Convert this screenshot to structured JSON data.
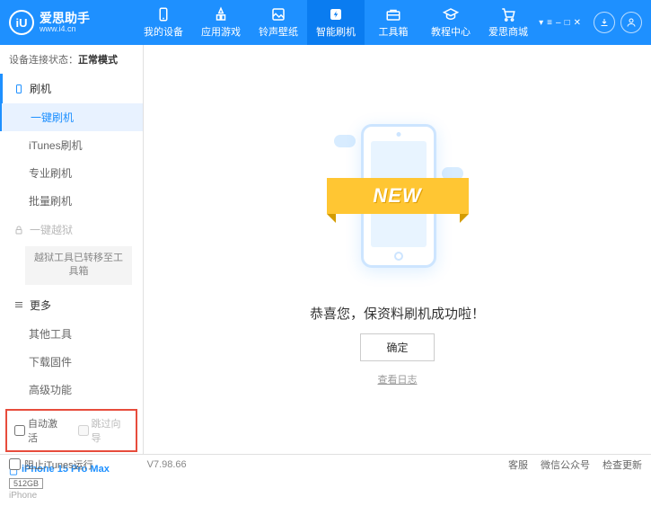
{
  "app": {
    "name": "爱思助手",
    "url": "www.i4.cn",
    "logo": "iU"
  },
  "nav": [
    {
      "label": "我的设备"
    },
    {
      "label": "应用游戏"
    },
    {
      "label": "铃声壁纸"
    },
    {
      "label": "智能刷机"
    },
    {
      "label": "工具箱"
    },
    {
      "label": "教程中心"
    },
    {
      "label": "爱思商城"
    }
  ],
  "status": {
    "prefix": "设备连接状态：",
    "value": "正常模式"
  },
  "sidebar": {
    "g1": {
      "title": "刷机",
      "items": [
        "一键刷机",
        "iTunes刷机",
        "专业刷机",
        "批量刷机"
      ]
    },
    "g2": {
      "title": "一键越狱",
      "note": "越狱工具已转移至工具箱"
    },
    "g3": {
      "title": "更多",
      "items": [
        "其他工具",
        "下载固件",
        "高级功能"
      ]
    }
  },
  "checks": {
    "auto": "自动激活",
    "skip": "跳过向导"
  },
  "device": {
    "name": "iPhone 15 Pro Max",
    "storage": "512GB",
    "type": "iPhone"
  },
  "main": {
    "banner": "NEW",
    "msg": "恭喜您，保资料刷机成功啦！",
    "ok": "确定",
    "log": "查看日志"
  },
  "footer": {
    "block": "阻止iTunes运行",
    "version": "V7.98.66",
    "links": [
      "客服",
      "微信公众号",
      "检查更新"
    ]
  }
}
